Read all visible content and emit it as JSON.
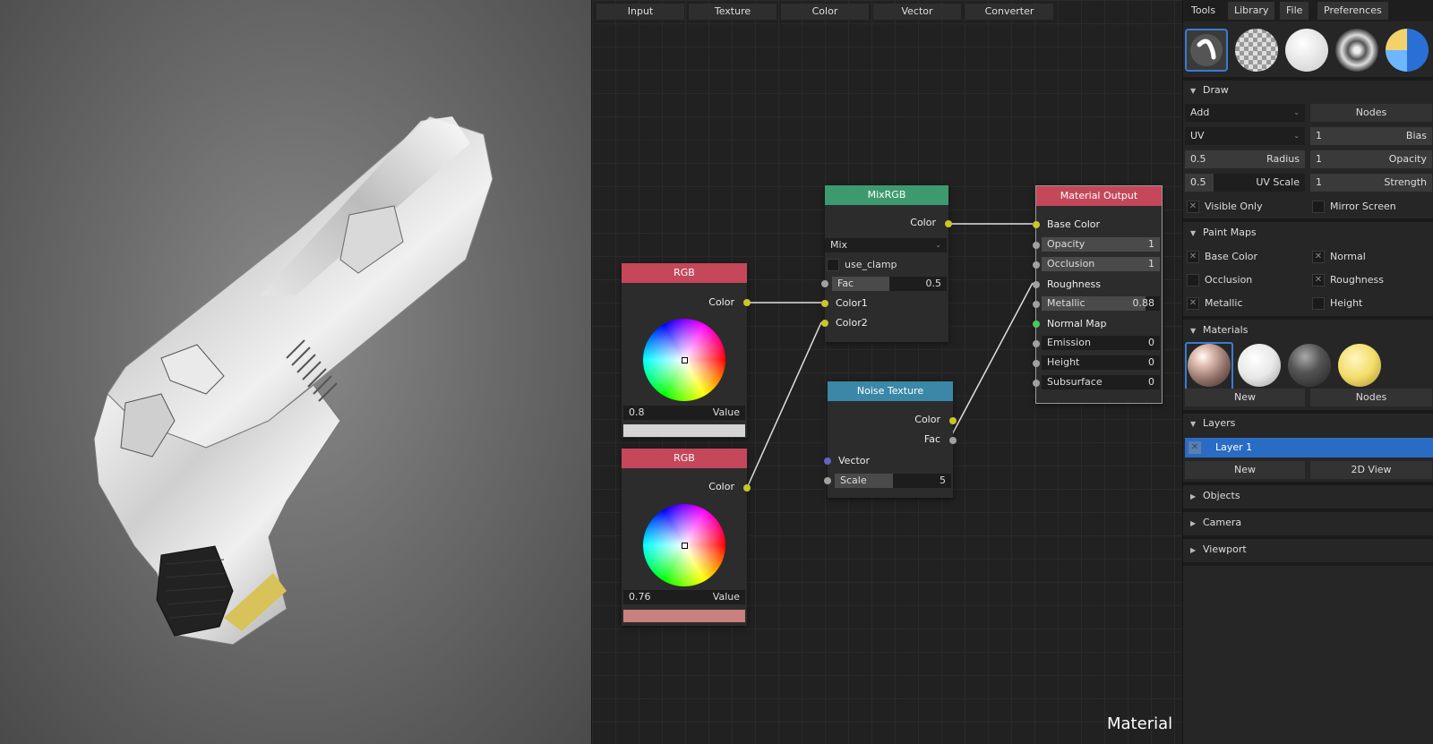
{
  "editor": {
    "menu": [
      "Input",
      "Texture",
      "Color",
      "Vector",
      "Converter"
    ],
    "label": "Material",
    "nodes": {
      "rgb1": {
        "title": "RGB",
        "color_label": "Color",
        "value": "0.8",
        "value_label": "Value",
        "swatch": "#d4d4d4",
        "header": "#c4475a"
      },
      "rgb2": {
        "title": "RGB",
        "color_label": "Color",
        "value": "0.76",
        "value_label": "Value",
        "swatch": "#c98080",
        "header": "#c4475a"
      },
      "mix": {
        "title": "MixRGB",
        "color_label": "Color",
        "mode": "Mix",
        "clamp_label": "use_clamp",
        "fac_label": "Fac",
        "fac_value": "0.5",
        "color1": "Color1",
        "color2": "Color2",
        "header": "#3d9a6e"
      },
      "noise": {
        "title": "Noise Texture",
        "color_label": "Color",
        "fac_label": "Fac",
        "vector_label": "Vector",
        "scale_label": "Scale",
        "scale_value": "5",
        "header": "#3b87a8"
      },
      "output": {
        "title": "Material Output",
        "header": "#c4475a",
        "base_color": "Base Color",
        "opacity": {
          "label": "Opacity",
          "value": "1"
        },
        "occlusion": {
          "label": "Occlusion",
          "value": "1"
        },
        "roughness": "Roughness",
        "metallic": {
          "label": "Metallic",
          "value": "0.88"
        },
        "normal_map": "Normal Map",
        "emission": {
          "label": "Emission",
          "value": "0"
        },
        "height": {
          "label": "Height",
          "value": "0"
        },
        "subsurface": {
          "label": "Subsurface",
          "value": "0"
        }
      }
    }
  },
  "panel": {
    "tabs": [
      "Tools",
      "Library",
      "File",
      "Preferences"
    ],
    "draw": {
      "title": "Draw",
      "mode": "Add",
      "nodes_btn": "Nodes",
      "uv": "UV",
      "bias": {
        "label": "Bias",
        "value": "1"
      },
      "radius": {
        "label": "Radius",
        "value": "0.5"
      },
      "opacity": {
        "label": "Opacity",
        "value": "1"
      },
      "uv_scale": {
        "label": "UV Scale",
        "value": "0.5"
      },
      "strength": {
        "label": "Strength",
        "value": "1"
      },
      "visible_only": "Visible Only",
      "mirror_screen": "Mirror Screen"
    },
    "paint_maps": {
      "title": "Paint Maps",
      "base_color": "Base Color",
      "normal": "Normal",
      "occlusion": "Occlusion",
      "roughness": "Roughness",
      "metallic": "Metallic",
      "height": "Height"
    },
    "materials": {
      "title": "Materials",
      "new_btn": "New",
      "nodes_btn": "Nodes"
    },
    "layers": {
      "title": "Layers",
      "layer1": "Layer 1",
      "new_btn": "New",
      "view_btn": "2D View"
    },
    "objects": "Objects",
    "camera": "Camera",
    "viewport": "Viewport"
  }
}
